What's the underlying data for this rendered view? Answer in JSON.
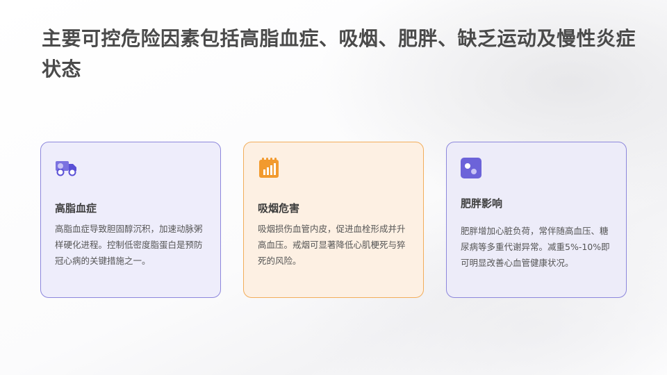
{
  "title": "主要可控危险因素包括高脂血症、吸烟、肥胖、缺乏运动及慢性炎症状态",
  "colors": {
    "purple_accent": "#6c63d9",
    "orange_accent": "#f29a2e",
    "card1_bg": "#eeedfb",
    "card2_bg": "#fdf0e3",
    "card3_bg": "#edecf9"
  },
  "cards": [
    {
      "icon": "delivery-truck-icon",
      "title": "高脂血症",
      "body": "高脂血症导致胆固醇沉积，加速动脉粥样硬化进程。控制低密度脂蛋白是预防冠心病的关键措施之一。"
    },
    {
      "icon": "bar-chart-notepad-icon",
      "title": "吸烟危害",
      "body": "吸烟损伤血管内皮，促进血栓形成并升高血压。戒烟可显著降低心肌梗死与猝死的风险。"
    },
    {
      "icon": "dots-square-icon",
      "title": "肥胖影响",
      "body": "肥胖增加心脏负荷，常伴随高血压、糖尿病等多重代谢异常。减重5%-10%即可明显改善心血管健康状况。"
    }
  ]
}
